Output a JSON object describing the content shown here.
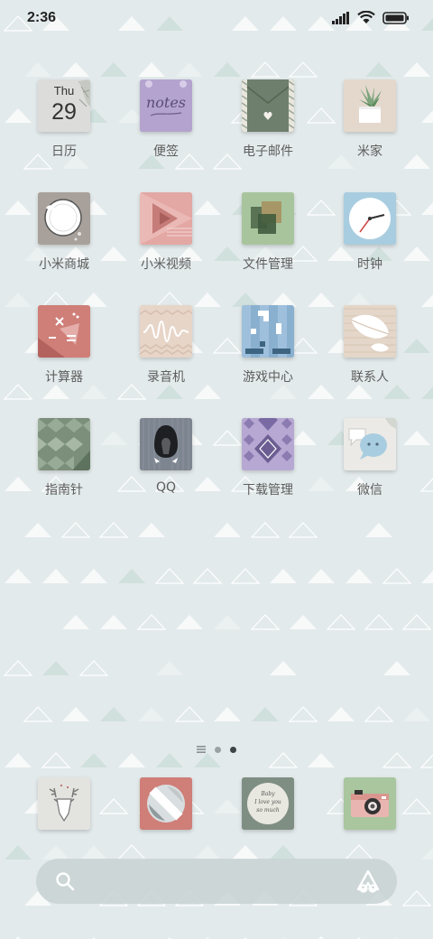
{
  "status": {
    "time": "2:36"
  },
  "apps": [
    {
      "label": "日历",
      "day": "Thu",
      "date": "29"
    },
    {
      "label": "便签",
      "icon_text": "notes"
    },
    {
      "label": "电子邮件"
    },
    {
      "label": "米家"
    },
    {
      "label": "小米商城"
    },
    {
      "label": "小米视频"
    },
    {
      "label": "文件管理"
    },
    {
      "label": "时钟"
    },
    {
      "label": "计算器"
    },
    {
      "label": "录音机"
    },
    {
      "label": "游戏中心"
    },
    {
      "label": "联系人"
    },
    {
      "label": "指南针"
    },
    {
      "label": "QQ"
    },
    {
      "label": "下载管理"
    },
    {
      "label": "微信"
    }
  ],
  "dock": {
    "app3_text": [
      "Baby",
      "I love you",
      "so much"
    ]
  },
  "page_indicator": {
    "pages": 2,
    "current": 2
  },
  "colors": {
    "background": "#e3eaeb",
    "calendar": "#dcdcda",
    "notes": "#b3a3ce",
    "mail": "#6e7f6e",
    "mihome": "#e8dcd0",
    "mall": "#a8a19b",
    "video": "#e3a7a4",
    "files": "#a8c49d",
    "clock": "#a9cde0",
    "calculator": "#cf7e78",
    "recorder": "#e7d5c8",
    "games": "#8ab0d0",
    "contacts": "#e4d6c8",
    "compass": "#7b8f7b",
    "qq": "#7d8590",
    "downloads": "#b6a8d2",
    "wechat": "#ebeae6"
  }
}
